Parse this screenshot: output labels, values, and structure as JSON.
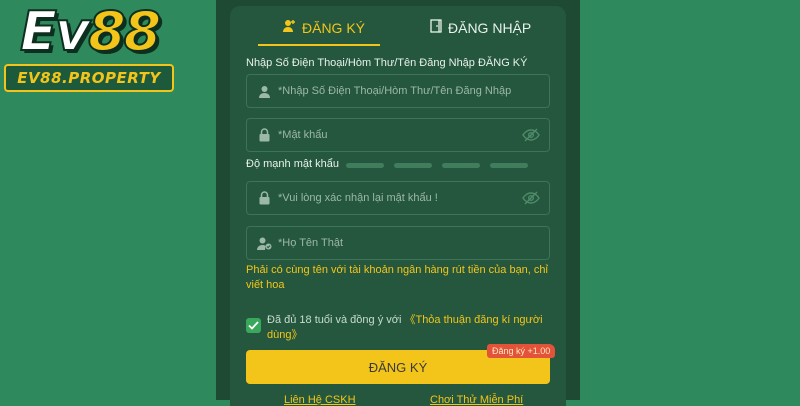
{
  "logo": {
    "brand_prefix": "Ev",
    "brand_number": "88",
    "domain": "EV88.PROPERTY"
  },
  "tabs": {
    "register_label": "ĐĂNG KÝ",
    "login_label": "ĐĂNG NHẬP"
  },
  "form": {
    "username_label": "Nhập Số Điện Thoại/Hòm Thư/Tên Đăng Nhập ĐĂNG KÝ",
    "username_placeholder": "*Nhập Số Điện Thoại/Hòm Thư/Tên Đăng Nhập",
    "password_placeholder": "*Mật khẩu",
    "strength_label": "Độ mạnh mật khẩu",
    "strength_bars": 4,
    "confirm_placeholder": "*Vui lòng xác nhận lại mật khẩu !",
    "realname_placeholder": "*Họ Tên Thật",
    "realname_hint": "Phải có cùng tên với tài khoản ngân hàng rút tiền của bạn, chỉ viết hoa",
    "agree_text": "Đã đủ 18 tuổi và đồng ý với",
    "agree_link": "《Thỏa thuận đăng kí người dùng》",
    "agree_checked": true,
    "submit_label": "ĐĂNG KÝ",
    "bonus_badge": "Đăng ký +1.00"
  },
  "footer": {
    "left_link": "Liên Hệ CSKH",
    "right_link": "Chơi Thử Miễn Phí"
  },
  "colors": {
    "accent": "#f3c51b",
    "background": "#2e8a5c",
    "panel": "#24573d",
    "badge": "#e3533a",
    "checkbox": "#3aa85b"
  }
}
